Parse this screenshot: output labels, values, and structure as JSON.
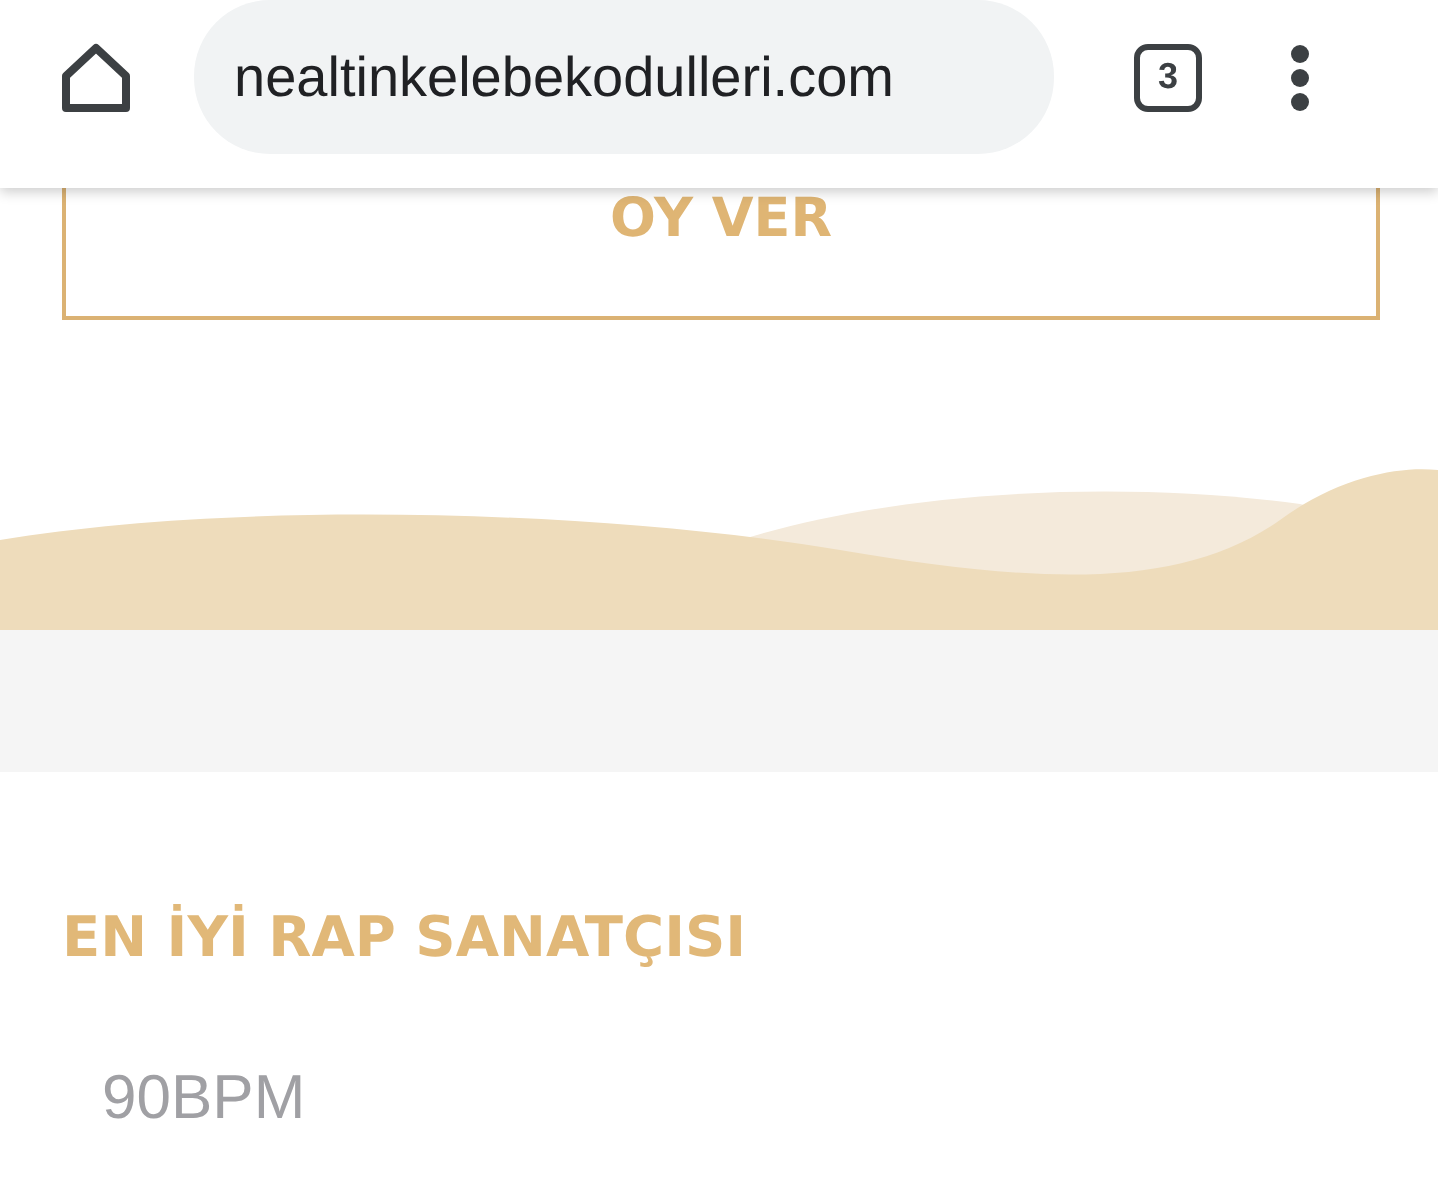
{
  "browser": {
    "url": "nealtinkelebekodulleri.com",
    "tab_count": "3"
  },
  "vote_button": {
    "label": "OY VER"
  },
  "category": {
    "title": "EN İYİ RAP SANATÇISI",
    "nominees": [
      "90BPM"
    ]
  }
}
